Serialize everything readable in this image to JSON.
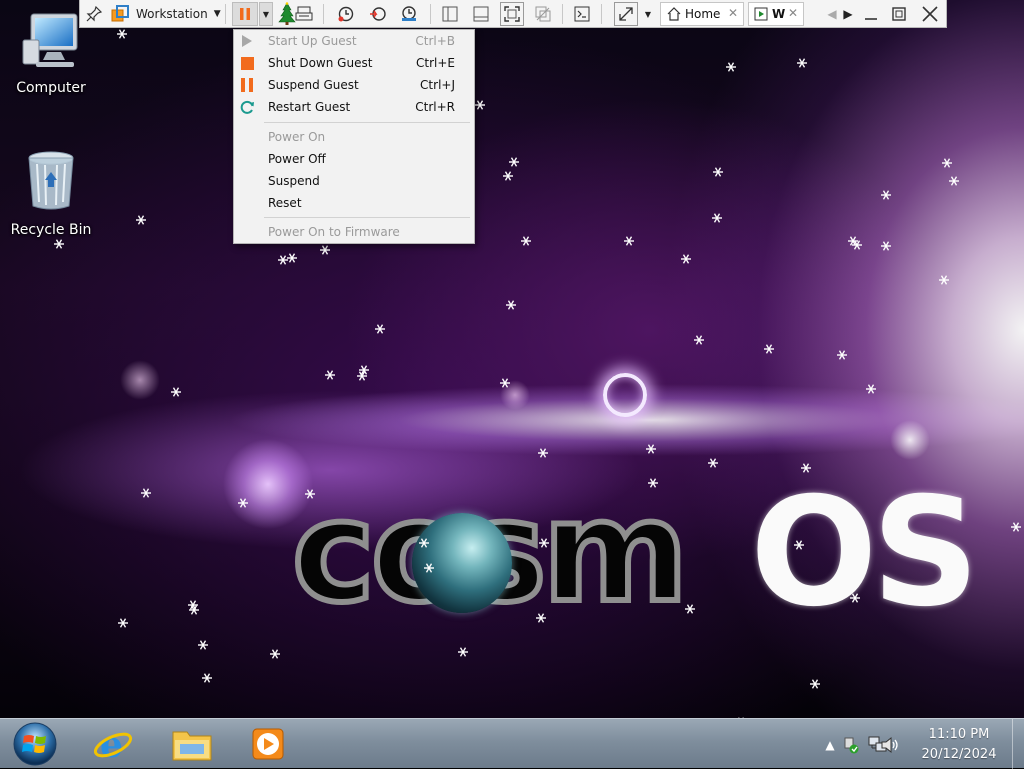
{
  "desktop": {
    "icons": [
      {
        "label": "Computer"
      },
      {
        "label": "Recycle Bin"
      }
    ],
    "logo": {
      "dark_part": "cosmOS",
      "light_part": "OS"
    }
  },
  "vm_toolbar": {
    "library_label": "Workstation",
    "tabs": [
      {
        "label": "Home"
      },
      {
        "label": "W"
      }
    ]
  },
  "power_menu": {
    "items": [
      {
        "label": "Start Up Guest",
        "shortcut": "Ctrl+B",
        "enabled": false,
        "icon": "play-icon"
      },
      {
        "label": "Shut Down Guest",
        "shortcut": "Ctrl+E",
        "enabled": true,
        "icon": "stop-icon"
      },
      {
        "label": "Suspend Guest",
        "shortcut": "Ctrl+J",
        "enabled": true,
        "icon": "pause-icon"
      },
      {
        "label": "Restart Guest",
        "shortcut": "Ctrl+R",
        "enabled": true,
        "icon": "restart-icon"
      },
      {
        "label": "Power On",
        "shortcut": "",
        "enabled": false
      },
      {
        "label": "Power Off",
        "shortcut": "",
        "enabled": true
      },
      {
        "label": "Suspend",
        "shortcut": "",
        "enabled": true
      },
      {
        "label": "Reset",
        "shortcut": "",
        "enabled": true
      },
      {
        "label": "Power On to Firmware",
        "shortcut": "",
        "enabled": false
      }
    ]
  },
  "taskbar": {
    "pinned": [
      {
        "name": "internet-explorer-icon"
      },
      {
        "name": "file-explorer-icon"
      },
      {
        "name": "media-player-icon"
      }
    ],
    "tray_icons": [
      "show-hidden-icons-icon",
      "usb-safe-remove-icon",
      "network-icon",
      "volume-icon"
    ],
    "clock": {
      "time": "11:10 PM",
      "date": "20/12/2024"
    }
  },
  "colors": {
    "accent_orange": "#f26b1d",
    "restart_teal": "#1b9a8f",
    "menu_bg": "#f2f2f2",
    "toolbar_bg": "#f4f4f4"
  }
}
